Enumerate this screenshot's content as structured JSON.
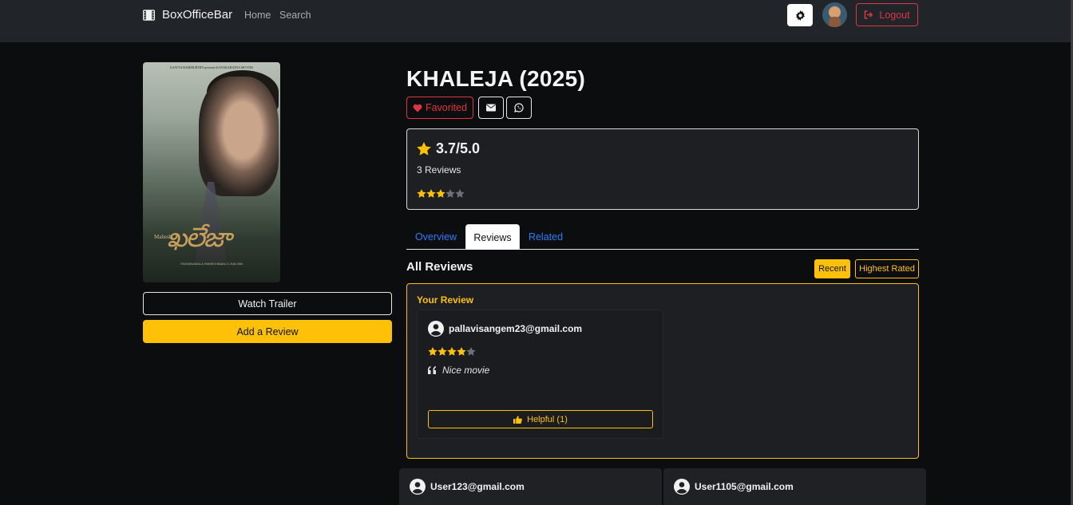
{
  "navbar": {
    "brand": "BoxOfficeBar",
    "links": [
      "Home",
      "Search"
    ],
    "logout_label": "Logout",
    "icons": [
      "film-icon",
      "gear-icon",
      "sign-out-icon"
    ]
  },
  "poster": {
    "top_text": "S.SATYA RAMMURTHY presents KANAKARATNA MOVIES",
    "logo": "ఖలేజా",
    "small_text": "Mahesh",
    "director": "TRIVIKRAM",
    "credits": "SINGANAMALA RAMESHBABU C.KALYAN"
  },
  "actions": {
    "watch_trailer": "Watch Trailer",
    "add_review": "Add a Review"
  },
  "movie": {
    "title": "KHALEJA (2025)",
    "favorited_label": "Favorited"
  },
  "rating": {
    "value": "3.7/5.0",
    "count": "3 Reviews",
    "stars_filled": 3,
    "stars_total": 5
  },
  "tabs": [
    {
      "label": "Overview",
      "active": false
    },
    {
      "label": "Reviews",
      "active": true
    },
    {
      "label": "Related",
      "active": false
    }
  ],
  "reviews_section": {
    "heading": "All Reviews",
    "sort_recent": "Recent",
    "sort_highest": "Highest Rated",
    "your_review_label": "Your Review"
  },
  "your_review": {
    "user": "pallavisangem23@gmail.com",
    "stars_filled": 4,
    "comment": "Nice movie",
    "helpful_label": "Helpful (1)"
  },
  "other_reviews": [
    {
      "user": "User123@gmail.com"
    },
    {
      "user": "User1105@gmail.com"
    }
  ],
  "colors": {
    "accent": "#ffc107",
    "danger": "#dc3545",
    "link": "#2f7bf5",
    "navbar": "#212429",
    "background": "#0c0d0f"
  }
}
